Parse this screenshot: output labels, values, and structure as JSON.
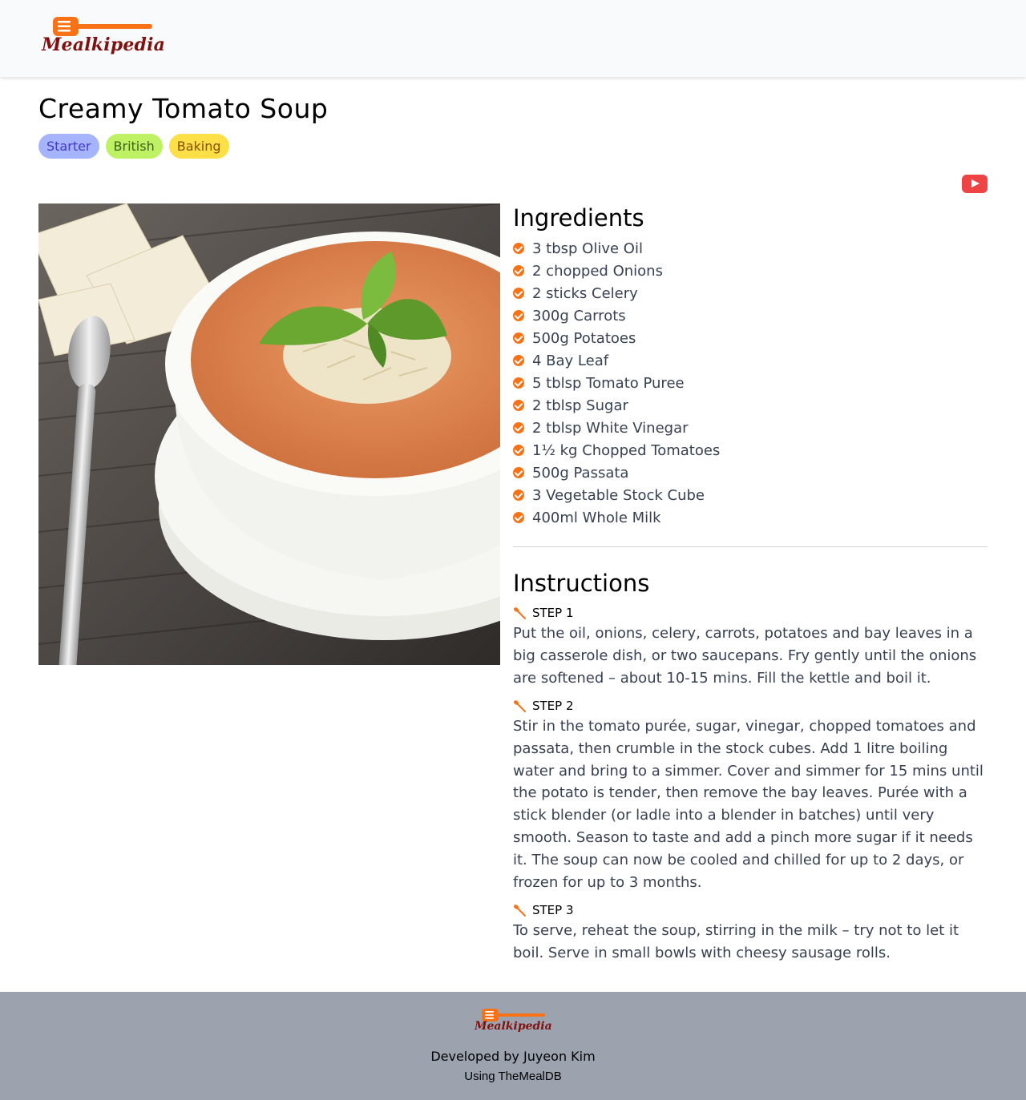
{
  "brand": {
    "name": "Mealkipedia",
    "primary_color": "#f97316",
    "wordmark_color": "#7f1111"
  },
  "recipe": {
    "title": "Creamy Tomato Soup",
    "tags": [
      "Starter",
      "British",
      "Baking"
    ],
    "video_icon": "youtube-icon",
    "image_alt": "Bowl of creamy tomato soup topped with basil and grated cheese"
  },
  "ingredients": {
    "heading": "Ingredients",
    "icon": "check-circle-icon",
    "items": [
      "3 tbsp Olive Oil",
      "2 chopped Onions",
      "2 sticks Celery",
      "300g Carrots",
      "500g Potatoes",
      "4 Bay Leaf",
      "5 tblsp Tomato Puree",
      "2 tblsp Sugar",
      "2 tblsp White Vinegar",
      "1½ kg Chopped Tomatoes",
      "500g Passata",
      "3 Vegetable Stock Cube",
      "400ml Whole Milk"
    ]
  },
  "instructions": {
    "heading": "Instructions",
    "icon": "spoon-icon",
    "steps": [
      {
        "label": "STEP 1",
        "text": "Put the oil, onions, celery, carrots, potatoes and bay leaves in a big casserole dish, or two saucepans. Fry gently until the onions are softened – about 10-15 mins. Fill the kettle and boil it."
      },
      {
        "label": "STEP 2",
        "text": "Stir in the tomato purée, sugar, vinegar, chopped tomatoes and passata, then crumble in the stock cubes. Add 1 litre boiling water and bring to a simmer. Cover and simmer for 15 mins until the potato is tender, then remove the bay leaves. Purée with a stick blender (or ladle into a blender in batches) until very smooth. Season to taste and add a pinch more sugar if it needs it. The soup can now be cooled and chilled for up to 2 days, or frozen for up to 3 months."
      },
      {
        "label": "STEP 3",
        "text": "To serve, reheat the soup, stirring in the milk – try not to let it boil. Serve in small bowls with cheesy sausage rolls."
      }
    ]
  },
  "footer": {
    "developed_by": "Developed by Juyeon Kim",
    "using": "Using TheMealDB"
  }
}
